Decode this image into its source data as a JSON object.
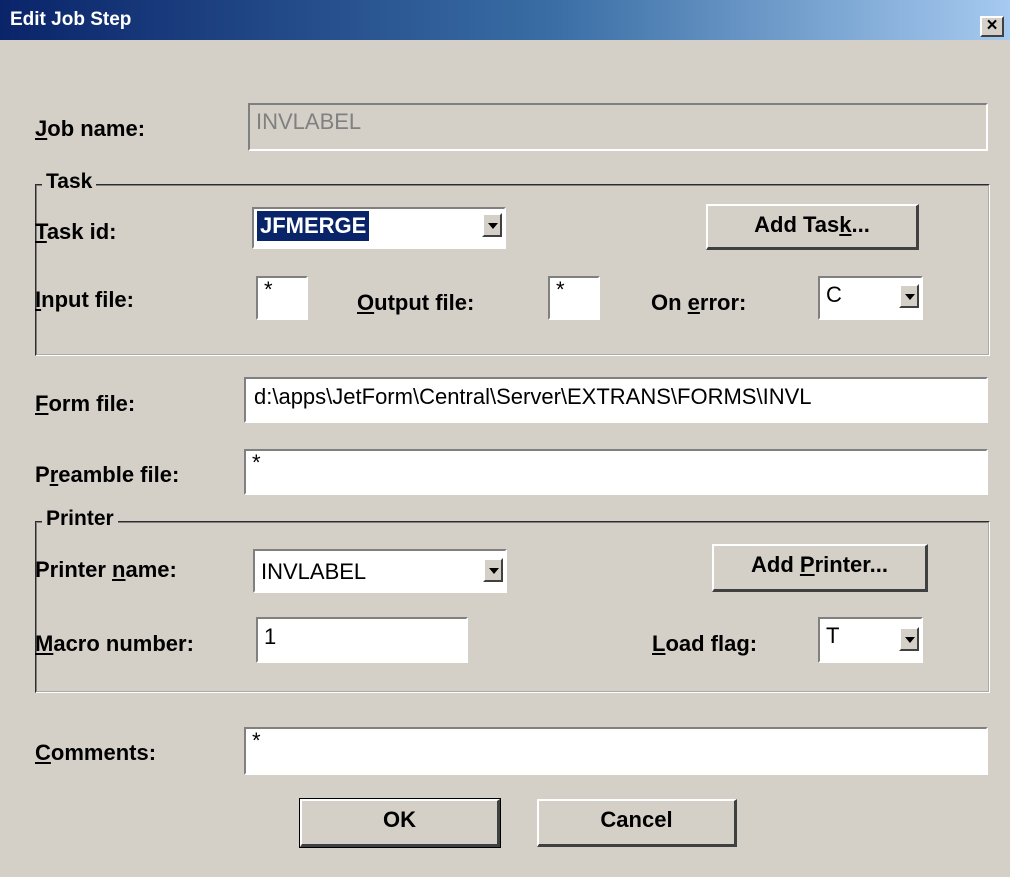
{
  "window": {
    "title": "Edit Job Step",
    "close_glyph": "×"
  },
  "job_name": {
    "label": "Job name:",
    "mnemonic": "J",
    "rest": "ob name:",
    "value": "INVLABEL"
  },
  "task_group": {
    "title": "Task"
  },
  "task_id": {
    "label_pre": "",
    "mnemonic": "T",
    "rest": "ask id:",
    "value": "JFMERGE"
  },
  "add_task": {
    "pre": "Add Tas",
    "mnemonic": "k",
    "post": "..."
  },
  "input_file": {
    "mnemonic": "I",
    "rest": "nput file:",
    "value": "*"
  },
  "output_file": {
    "mnemonic": "O",
    "rest": "utput file:",
    "value": "*"
  },
  "on_error": {
    "pre": "On ",
    "mnemonic": "e",
    "rest": "rror:",
    "value": "C"
  },
  "form_file": {
    "mnemonic": "F",
    "rest": "orm file:",
    "value": "d:\\apps\\JetForm\\Central\\Server\\EXTRANS\\FORMS\\INVL"
  },
  "preamble_file": {
    "pre": "P",
    "mnemonic": "r",
    "rest": "eamble file:",
    "value": "*"
  },
  "printer_group": {
    "title": "Printer"
  },
  "printer_name": {
    "pre": "Printer ",
    "mnemonic": "n",
    "rest": "ame:",
    "value": "INVLABEL"
  },
  "add_printer": {
    "pre": "Add ",
    "mnemonic": "P",
    "post": "rinter..."
  },
  "macro_number": {
    "mnemonic": "M",
    "rest": "acro number:",
    "value": "1"
  },
  "load_flag": {
    "mnemonic": "L",
    "rest": "oad flag:",
    "value": "T"
  },
  "comments": {
    "mnemonic": "C",
    "rest": "omments:",
    "value": "*"
  },
  "ok_button": {
    "label": "OK"
  },
  "cancel_button": {
    "label": "Cancel"
  }
}
